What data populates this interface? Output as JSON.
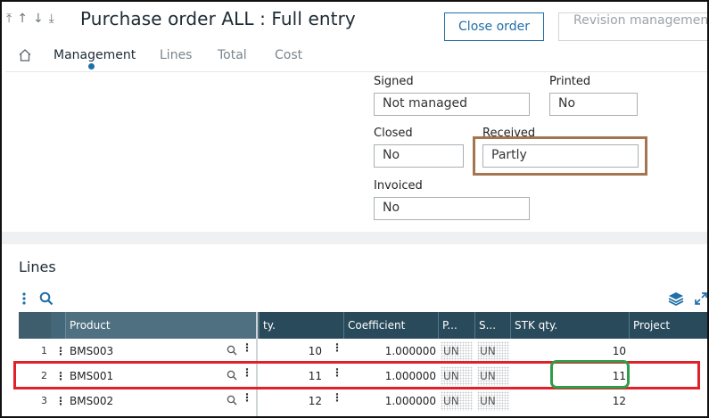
{
  "header": {
    "title": "Purchase order ALL : Full entry",
    "close_order_label": "Close order",
    "revision_label": "Revision management"
  },
  "tabs": [
    {
      "label": "Management",
      "active": true
    },
    {
      "label": "Lines",
      "active": false
    },
    {
      "label": "Total",
      "active": false
    },
    {
      "label": "Cost",
      "active": false
    }
  ],
  "fields": {
    "signed": {
      "label": "Signed",
      "value": "Not managed"
    },
    "printed": {
      "label": "Printed",
      "value": "No"
    },
    "closed": {
      "label": "Closed",
      "value": "No"
    },
    "received": {
      "label": "Received",
      "value": "Partly"
    },
    "invoiced": {
      "label": "Invoiced",
      "value": "No"
    }
  },
  "lines": {
    "title": "Lines",
    "columns": {
      "product": "Product",
      "qty": "ty.",
      "coefficient": "Coefficient",
      "p": "P...",
      "s": "S...",
      "stk_qty": "STK qty.",
      "project": "Project"
    },
    "rows": [
      {
        "num": "1",
        "product": "BMS003",
        "qty": "10",
        "coefficient": "1.000000",
        "p": "UN",
        "s": "UN",
        "stk_qty": "10",
        "project": ""
      },
      {
        "num": "2",
        "product": "BMS001",
        "qty": "11",
        "coefficient": "1.000000",
        "p": "UN",
        "s": "UN",
        "stk_qty": "11",
        "project": ""
      },
      {
        "num": "3",
        "product": "BMS002",
        "qty": "12",
        "coefficient": "1.000000",
        "p": "UN",
        "s": "UN",
        "stk_qty": "12",
        "project": ""
      }
    ]
  },
  "colors": {
    "accent": "#1f6fa8",
    "header_dark": "#294a5a",
    "highlight_red": "#e0202a",
    "highlight_green": "#2e9e49",
    "highlight_brown": "#a57550"
  },
  "icons": {
    "arrows": [
      "arrow-up-first-icon",
      "arrow-up-icon",
      "arrow-down-icon",
      "arrow-down-last-icon"
    ],
    "home": "home-icon",
    "menu": "vertical-dots-icon",
    "search": "search-icon",
    "layers": "layers-icon",
    "expand": "expand-icon"
  }
}
